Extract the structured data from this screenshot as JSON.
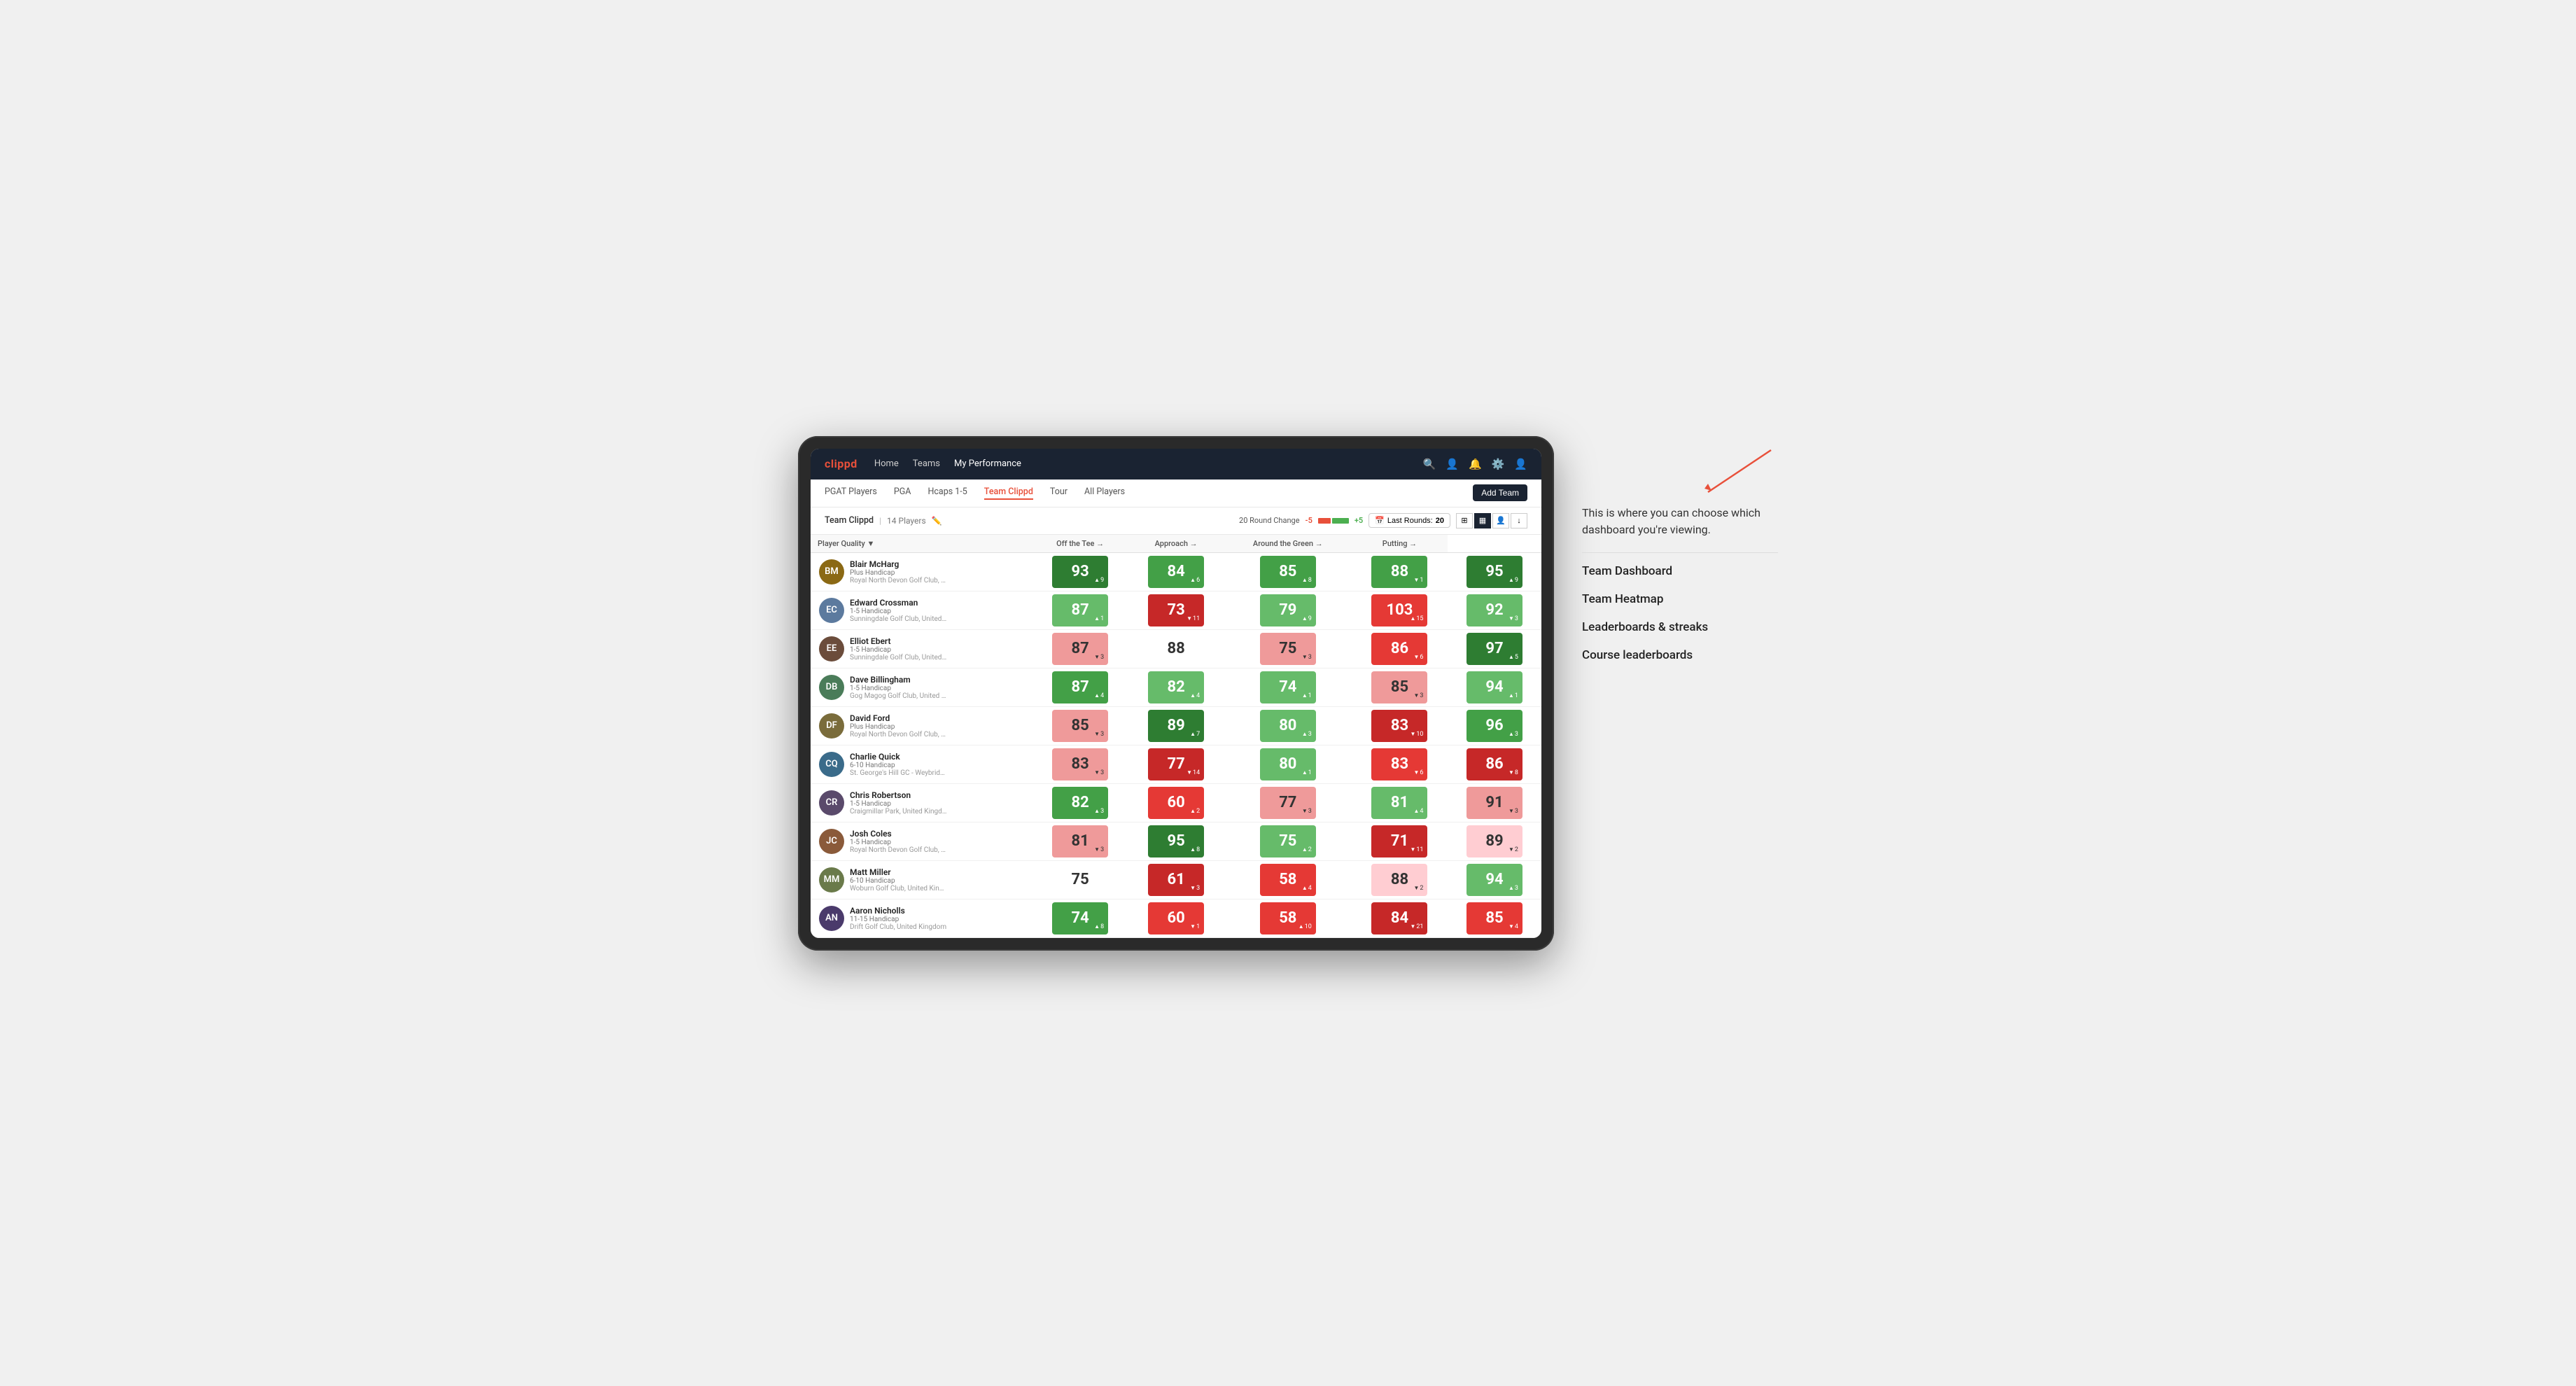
{
  "annotation": {
    "description": "This is where you can choose which dashboard you're viewing.",
    "items": [
      "Team Dashboard",
      "Team Heatmap",
      "Leaderboards & streaks",
      "Course leaderboards"
    ]
  },
  "nav": {
    "logo": "clippd",
    "links": [
      "Home",
      "Teams",
      "My Performance"
    ],
    "active_link": "My Performance"
  },
  "subnav": {
    "links": [
      "PGAT Players",
      "PGA",
      "Hcaps 1-5",
      "Team Clippd",
      "Tour",
      "All Players"
    ],
    "active": "Team Clippd",
    "add_button": "Add Team"
  },
  "team_header": {
    "name": "Team Clippd",
    "separator": "|",
    "count": "14 Players",
    "round_change_label": "20 Round Change",
    "change_minus": "-5",
    "change_plus": "+5",
    "last_rounds_label": "Last Rounds:",
    "last_rounds_value": "20"
  },
  "table": {
    "columns": {
      "player": "Player Quality ▼",
      "off_tee": "Off the Tee →",
      "approach": "Approach →",
      "around_green": "Around the Green →",
      "putting": "Putting →"
    },
    "rows": [
      {
        "name": "Blair McHarg",
        "handicap": "Plus Handicap",
        "club": "Royal North Devon Golf Club, United Kingdom",
        "initials": "BM",
        "color": "#8B6914",
        "scores": {
          "quality": {
            "value": 93,
            "delta": "+9",
            "dir": "up",
            "color": "green-dark"
          },
          "off_tee": {
            "value": 84,
            "delta": "+6",
            "dir": "up",
            "color": "green-mid"
          },
          "approach": {
            "value": 85,
            "delta": "+8",
            "dir": "up",
            "color": "green-mid"
          },
          "around_green": {
            "value": 88,
            "delta": "-1",
            "dir": "down",
            "color": "green-mid"
          },
          "putting": {
            "value": 95,
            "delta": "+9",
            "dir": "up",
            "color": "green-dark"
          }
        }
      },
      {
        "name": "Edward Crossman",
        "handicap": "1-5 Handicap",
        "club": "Sunningdale Golf Club, United Kingdom",
        "initials": "EC",
        "color": "#5c7a9e",
        "scores": {
          "quality": {
            "value": 87,
            "delta": "+1",
            "dir": "up",
            "color": "green-light"
          },
          "off_tee": {
            "value": 73,
            "delta": "-11",
            "dir": "down",
            "color": "red-dark"
          },
          "approach": {
            "value": 79,
            "delta": "+9",
            "dir": "up",
            "color": "green-light"
          },
          "around_green": {
            "value": 103,
            "delta": "+15",
            "dir": "up",
            "color": "red-mid"
          },
          "putting": {
            "value": 92,
            "delta": "-3",
            "dir": "down",
            "color": "green-light"
          }
        }
      },
      {
        "name": "Elliot Ebert",
        "handicap": "1-5 Handicap",
        "club": "Sunningdale Golf Club, United Kingdom",
        "initials": "EE",
        "color": "#6b4c3b",
        "scores": {
          "quality": {
            "value": 87,
            "delta": "-3",
            "dir": "down",
            "color": "red-light"
          },
          "off_tee": {
            "value": 88,
            "delta": "",
            "dir": "",
            "color": "neutral"
          },
          "approach": {
            "value": 75,
            "delta": "-3",
            "dir": "down",
            "color": "red-light"
          },
          "around_green": {
            "value": 86,
            "delta": "-6",
            "dir": "down",
            "color": "red-mid"
          },
          "putting": {
            "value": 97,
            "delta": "+5",
            "dir": "up",
            "color": "green-dark"
          }
        }
      },
      {
        "name": "Dave Billingham",
        "handicap": "1-5 Handicap",
        "club": "Gog Magog Golf Club, United Kingdom",
        "initials": "DB",
        "color": "#4a7c59",
        "scores": {
          "quality": {
            "value": 87,
            "delta": "+4",
            "dir": "up",
            "color": "green-mid"
          },
          "off_tee": {
            "value": 82,
            "delta": "+4",
            "dir": "up",
            "color": "green-light"
          },
          "approach": {
            "value": 74,
            "delta": "+1",
            "dir": "up",
            "color": "green-light"
          },
          "around_green": {
            "value": 85,
            "delta": "-3",
            "dir": "down",
            "color": "red-light"
          },
          "putting": {
            "value": 94,
            "delta": "+1",
            "dir": "up",
            "color": "green-light"
          }
        }
      },
      {
        "name": "David Ford",
        "handicap": "Plus Handicap",
        "club": "Royal North Devon Golf Club, United Kingdom",
        "initials": "DF",
        "color": "#7a6c3b",
        "scores": {
          "quality": {
            "value": 85,
            "delta": "-3",
            "dir": "down",
            "color": "red-light"
          },
          "off_tee": {
            "value": 89,
            "delta": "+7",
            "dir": "up",
            "color": "green-dark"
          },
          "approach": {
            "value": 80,
            "delta": "+3",
            "dir": "up",
            "color": "green-light"
          },
          "around_green": {
            "value": 83,
            "delta": "-10",
            "dir": "down",
            "color": "red-dark"
          },
          "putting": {
            "value": 96,
            "delta": "+3",
            "dir": "up",
            "color": "green-mid"
          }
        }
      },
      {
        "name": "Charlie Quick",
        "handicap": "6-10 Handicap",
        "club": "St. George's Hill GC - Weybridge - Surrey, Uni...",
        "initials": "CQ",
        "color": "#3a6b8a",
        "scores": {
          "quality": {
            "value": 83,
            "delta": "-3",
            "dir": "down",
            "color": "red-light"
          },
          "off_tee": {
            "value": 77,
            "delta": "-14",
            "dir": "down",
            "color": "red-dark"
          },
          "approach": {
            "value": 80,
            "delta": "+1",
            "dir": "up",
            "color": "green-light"
          },
          "around_green": {
            "value": 83,
            "delta": "-6",
            "dir": "down",
            "color": "red-mid"
          },
          "putting": {
            "value": 86,
            "delta": "-8",
            "dir": "down",
            "color": "red-dark"
          }
        }
      },
      {
        "name": "Chris Robertson",
        "handicap": "1-5 Handicap",
        "club": "Craigmillar Park, United Kingdom",
        "initials": "CR",
        "color": "#5a4a6b",
        "scores": {
          "quality": {
            "value": 82,
            "delta": "+3",
            "dir": "up",
            "color": "green-mid"
          },
          "off_tee": {
            "value": 60,
            "delta": "+2",
            "dir": "up",
            "color": "red-mid"
          },
          "approach": {
            "value": 77,
            "delta": "-3",
            "dir": "down",
            "color": "red-light"
          },
          "around_green": {
            "value": 81,
            "delta": "+4",
            "dir": "up",
            "color": "green-light"
          },
          "putting": {
            "value": 91,
            "delta": "-3",
            "dir": "down",
            "color": "red-light"
          }
        }
      },
      {
        "name": "Josh Coles",
        "handicap": "1-5 Handicap",
        "club": "Royal North Devon Golf Club, United Kingdom",
        "initials": "JC",
        "color": "#8a5a3a",
        "scores": {
          "quality": {
            "value": 81,
            "delta": "-3",
            "dir": "down",
            "color": "red-light"
          },
          "off_tee": {
            "value": 95,
            "delta": "+8",
            "dir": "up",
            "color": "green-dark"
          },
          "approach": {
            "value": 75,
            "delta": "+2",
            "dir": "up",
            "color": "green-light"
          },
          "around_green": {
            "value": 71,
            "delta": "-11",
            "dir": "down",
            "color": "red-dark"
          },
          "putting": {
            "value": 89,
            "delta": "-2",
            "dir": "down",
            "color": "pink-light"
          }
        }
      },
      {
        "name": "Matt Miller",
        "handicap": "6-10 Handicap",
        "club": "Woburn Golf Club, United Kingdom",
        "initials": "MM",
        "color": "#6a7a4a",
        "scores": {
          "quality": {
            "value": 75,
            "delta": "",
            "dir": "",
            "color": "neutral"
          },
          "off_tee": {
            "value": 61,
            "delta": "-3",
            "dir": "down",
            "color": "red-dark"
          },
          "approach": {
            "value": 58,
            "delta": "+4",
            "dir": "up",
            "color": "red-mid"
          },
          "around_green": {
            "value": 88,
            "delta": "-2",
            "dir": "down",
            "color": "pink-light"
          },
          "putting": {
            "value": 94,
            "delta": "+3",
            "dir": "up",
            "color": "green-light"
          }
        }
      },
      {
        "name": "Aaron Nicholls",
        "handicap": "11-15 Handicap",
        "club": "Drift Golf Club, United Kingdom",
        "initials": "AN",
        "color": "#4a3a6b",
        "scores": {
          "quality": {
            "value": 74,
            "delta": "+8",
            "dir": "up",
            "color": "green-mid"
          },
          "off_tee": {
            "value": 60,
            "delta": "-1",
            "dir": "down",
            "color": "red-mid"
          },
          "approach": {
            "value": 58,
            "delta": "+10",
            "dir": "up",
            "color": "red-mid"
          },
          "around_green": {
            "value": 84,
            "delta": "-21",
            "dir": "down",
            "color": "red-dark"
          },
          "putting": {
            "value": 85,
            "delta": "-4",
            "dir": "down",
            "color": "red-mid"
          }
        }
      }
    ]
  }
}
